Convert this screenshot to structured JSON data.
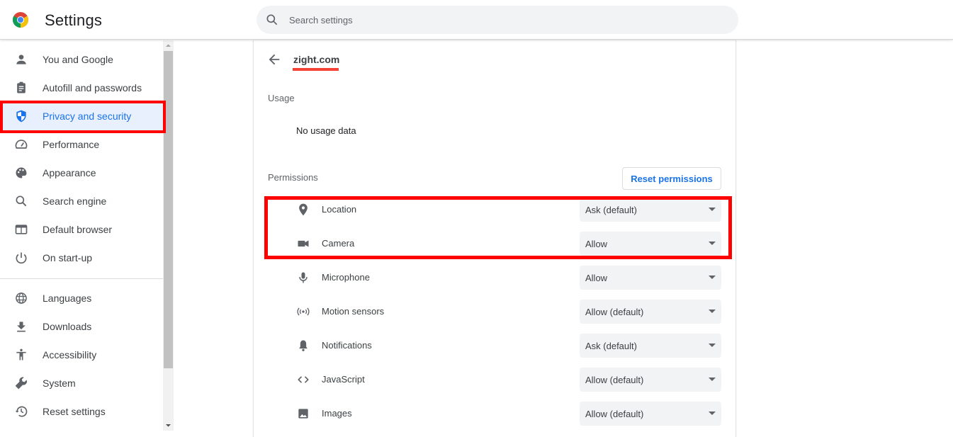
{
  "header": {
    "app_title": "Settings",
    "search_placeholder": "Search settings",
    "search_value": ""
  },
  "sidebar": {
    "items": [
      {
        "label": "You and Google",
        "icon": "person-icon"
      },
      {
        "label": "Autofill and passwords",
        "icon": "clipboard-icon"
      },
      {
        "label": "Privacy and security",
        "icon": "shield-icon",
        "active": true
      },
      {
        "label": "Performance",
        "icon": "speedometer-icon"
      },
      {
        "label": "Appearance",
        "icon": "palette-icon"
      },
      {
        "label": "Search engine",
        "icon": "search-icon"
      },
      {
        "label": "Default browser",
        "icon": "browser-window-icon"
      },
      {
        "label": "On start-up",
        "icon": "power-icon"
      },
      {
        "label": "Languages",
        "icon": "globe-icon"
      },
      {
        "label": "Downloads",
        "icon": "download-icon"
      },
      {
        "label": "Accessibility",
        "icon": "accessibility-icon"
      },
      {
        "label": "System",
        "icon": "wrench-icon"
      },
      {
        "label": "Reset settings",
        "icon": "history-icon"
      }
    ]
  },
  "site": {
    "title": "zight.com",
    "usage_label": "Usage",
    "usage_value": "No usage data",
    "permissions_label": "Permissions",
    "reset_label": "Reset permissions",
    "permissions": [
      {
        "label": "Location",
        "value": "Ask (default)",
        "icon": "location-pin-icon"
      },
      {
        "label": "Camera",
        "value": "Allow",
        "icon": "camera-icon"
      },
      {
        "label": "Microphone",
        "value": "Allow",
        "icon": "microphone-icon"
      },
      {
        "label": "Motion sensors",
        "value": "Allow (default)",
        "icon": "motion-sensors-icon"
      },
      {
        "label": "Notifications",
        "value": "Ask (default)",
        "icon": "bell-icon"
      },
      {
        "label": "JavaScript",
        "value": "Allow (default)",
        "icon": "code-icon"
      },
      {
        "label": "Images",
        "value": "Allow (default)",
        "icon": "image-icon"
      }
    ]
  },
  "colors": {
    "accent": "#1a73e8",
    "active_bg": "#e8f0fe",
    "annotation_red": "#ff0000",
    "underline_red": "#f44336"
  }
}
